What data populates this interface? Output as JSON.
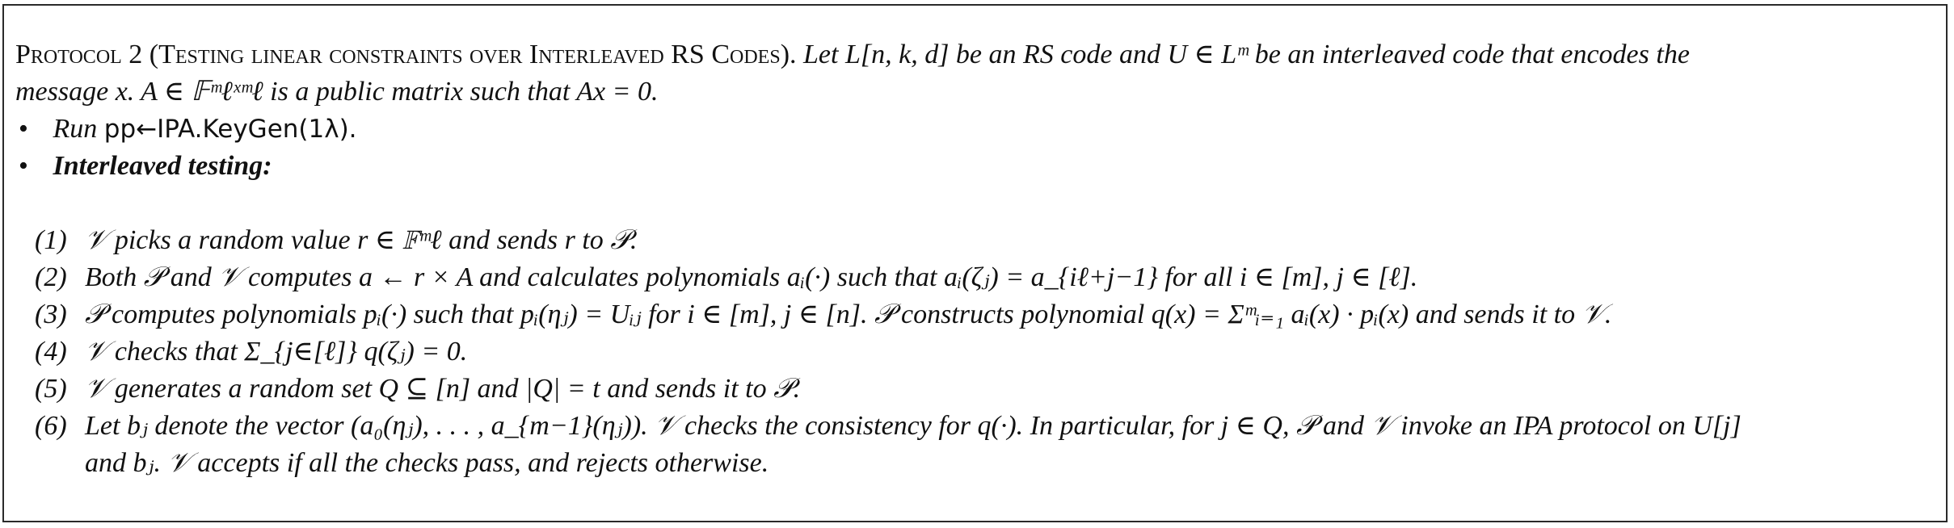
{
  "protocol": {
    "title_label": "Protocol 2 (Testing linear constraints over Interleaved RS Codes).",
    "intro_line1": "Let L[n, k, d] be an RS code and U ∈ Lᵐ be an interleaved code that encodes the",
    "intro_line2": "message x. A ∈ 𝔽ᵐℓˣᵐℓ is a public matrix such that Ax = 0.",
    "bullets": [
      {
        "marker": "•",
        "run_label": "Run",
        "run_value": "pp←IPA.KeyGen(1λ)."
      },
      {
        "marker": "•",
        "label": "Interleaved testing:"
      }
    ],
    "steps": [
      {
        "num": "(1)",
        "text": "𝒱 picks a random value r ∈ 𝔽ᵐℓ and sends r to 𝒫."
      },
      {
        "num": "(2)",
        "text": "Both 𝒫 and 𝒱 computes a ← r × A and calculates polynomials aᵢ(·) such that aᵢ(ζⱼ) = a_{iℓ+j−1} for all i ∈ [m], j ∈ [ℓ]."
      },
      {
        "num": "(3)",
        "text": "𝒫 computes polynomials pᵢ(·) such that pᵢ(ηⱼ) = Uᵢⱼ for i ∈ [m], j ∈ [n]. 𝒫 constructs polynomial q(x) = Σᵐᵢ₌₁ aᵢ(x) · pᵢ(x) and sends it to 𝒱."
      },
      {
        "num": "(4)",
        "text": "𝒱 checks that Σ_{j∈[ℓ]} q(ζⱼ) = 0."
      },
      {
        "num": "(5)",
        "text": "𝒱 generates a random set Q ⊆ [n] and |Q| = t and sends it to 𝒫."
      },
      {
        "num": "(6)",
        "text": "Let bⱼ denote the vector (a₀(ηⱼ), . . . , a_{m−1}(ηⱼ)). 𝒱 checks the consistency for q(·). In particular, for j ∈ Q, 𝒫 and 𝒱 invoke an IPA protocol on U[j]",
        "continuation": "and bⱼ. 𝒱 accepts if all the checks pass, and rejects otherwise."
      }
    ]
  }
}
